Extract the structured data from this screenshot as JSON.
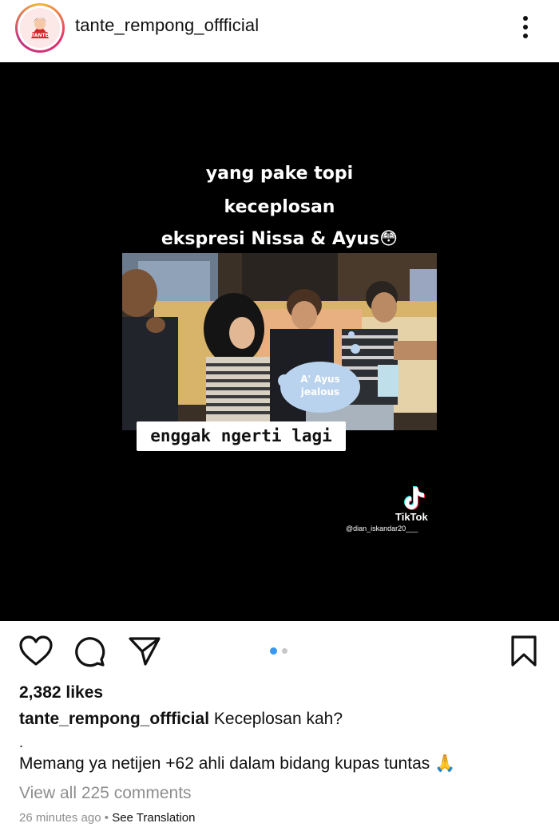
{
  "post": {
    "username": "tante_rempong_offficial",
    "avatar_text": "TANTE"
  },
  "media": {
    "caption_lines": [
      "yang pake topi",
      "keceplosan",
      "ekspresi Nissa & Ayus😳"
    ],
    "bubble_text": "A' Ayus\njealous",
    "bottom_label": "enggak ngerti lagi",
    "tiktok_label": "TikTok",
    "tiktok_handle": "@dian_iskandar20___"
  },
  "carousel": {
    "count": 2,
    "active": 0,
    "active_color": "#3897f0",
    "inactive_color": "#c7c7c7"
  },
  "footer": {
    "likes": "2,382 likes",
    "caption_user": "tante_rempong_offficial",
    "caption_text": "Keceplosan kah?",
    "caption_dot": ".",
    "caption_line2": "Memang ya netijen +62 ahli dalam bidang kupas tuntas 🙏",
    "view_comments": "View all 225 comments",
    "time": "26 minutes ago",
    "separator": "•",
    "see_translation": "See Translation"
  },
  "icons": [
    "more-vertical-icon",
    "heart-icon",
    "comment-icon",
    "share-icon",
    "bookmark-icon",
    "tiktok-icon"
  ]
}
